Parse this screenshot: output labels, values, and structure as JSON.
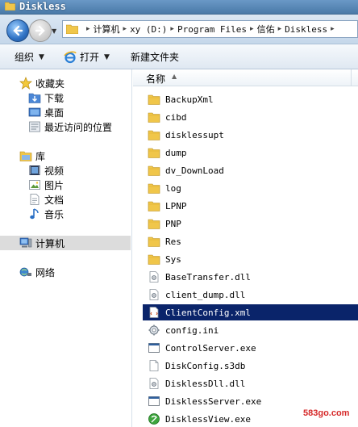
{
  "window": {
    "title": "Diskless"
  },
  "address": {
    "crumbs": [
      "计算机",
      "xy (D:)",
      "Program Files",
      "信佑",
      "Diskless"
    ]
  },
  "toolbar": {
    "organize": "组织",
    "open": "打开",
    "new_folder": "新建文件夹"
  },
  "nav": {
    "favorites": {
      "label": "收藏夹",
      "items": [
        "下载",
        "桌面",
        "最近访问的位置"
      ]
    },
    "libraries": {
      "label": "库",
      "items": [
        "视频",
        "图片",
        "文档",
        "音乐"
      ]
    },
    "computer": "计算机",
    "network": "网络"
  },
  "content": {
    "column_name": "名称",
    "files": [
      {
        "name": "BackupXml",
        "icon": "folder-icon"
      },
      {
        "name": "cibd",
        "icon": "folder-icon"
      },
      {
        "name": "disklessupt",
        "icon": "folder-icon"
      },
      {
        "name": "dump",
        "icon": "folder-icon"
      },
      {
        "name": "dv_DownLoad",
        "icon": "folder-icon"
      },
      {
        "name": "log",
        "icon": "folder-icon"
      },
      {
        "name": "LPNP",
        "icon": "folder-icon"
      },
      {
        "name": "PNP",
        "icon": "folder-icon"
      },
      {
        "name": "Res",
        "icon": "folder-icon"
      },
      {
        "name": "Sys",
        "icon": "folder-icon"
      },
      {
        "name": "BaseTransfer.dll",
        "icon": "dll-icon"
      },
      {
        "name": "client_dump.dll",
        "icon": "dll-icon"
      },
      {
        "name": "ClientConfig.xml",
        "icon": "xml-icon",
        "selected": true
      },
      {
        "name": "config.ini",
        "icon": "ini-icon"
      },
      {
        "name": "ControlServer.exe",
        "icon": "exe-icon"
      },
      {
        "name": "DiskConfig.s3db",
        "icon": "file-icon"
      },
      {
        "name": "DisklessDll.dll",
        "icon": "dll-icon"
      },
      {
        "name": "DisklessServer.exe",
        "icon": "exe-icon"
      },
      {
        "name": "DisklessView.exe",
        "icon": "app-green-icon"
      }
    ]
  },
  "watermark": "583go.com",
  "colors": {
    "selection": "#0a246a",
    "titlebar": "#4a7aa8"
  }
}
